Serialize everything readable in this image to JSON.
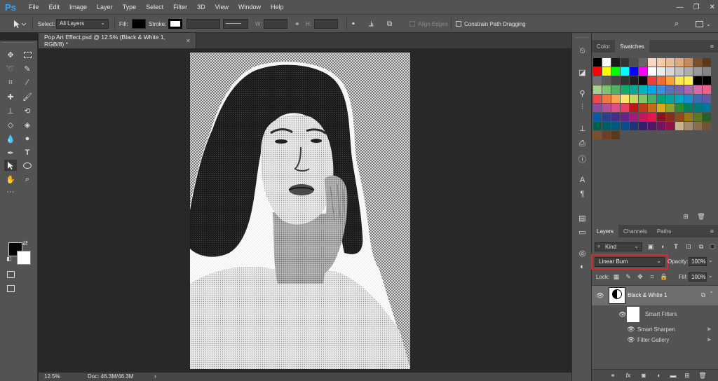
{
  "app": {
    "logo": "Ps"
  },
  "menu": [
    "File",
    "Edit",
    "Image",
    "Layer",
    "Type",
    "Select",
    "Filter",
    "3D",
    "View",
    "Window",
    "Help"
  ],
  "window_controls": {
    "minimize": "—",
    "restore": "❐",
    "close": "✕"
  },
  "options_bar": {
    "select_label": "Select:",
    "select_value": "All Layers",
    "fill_label": "Fill:",
    "stroke_label": "Stroke:",
    "w_label": "W:",
    "h_label": "H:",
    "align_edges_label": "Align Edges",
    "constrain_label": "Constrain Path Dragging",
    "fill_color": "#000000"
  },
  "document": {
    "tab_title": "Pop Art Effect.psd @ 12.5% (Black & White 1, RGB/8) *",
    "close": "×"
  },
  "status": {
    "zoom": "12.5%",
    "doc_info": "Doc: 46.3M/46.3M",
    "arrow": "›"
  },
  "colors": {
    "foreground": "#050505",
    "background": "#ffffff",
    "accent_highlight": "#e0262d"
  },
  "swatches_panel": {
    "tabs": [
      "Color",
      "Swatches"
    ],
    "active_tab": "Swatches",
    "rows": [
      [
        "#000000",
        "#ffffff",
        "#1a1a1a",
        "#333333",
        "#4d4d4d",
        "#666666",
        "#fbd7c2",
        "#f6c9a9",
        "#eebc96",
        "#e0a97e",
        "#c68a5d",
        "#7a4f2b",
        "#5a3a1d"
      ],
      [
        "#ff0000",
        "#ffff00",
        "#00ff00",
        "#00ffff",
        "#0000ff",
        "#ff00ff",
        "#ffffff",
        "#ebebeb",
        "#d6d6d6",
        "#c2c2c2",
        "#adadad",
        "#999999",
        "#858585"
      ],
      [
        "#707070",
        "#5c5c5c",
        "#474747",
        "#333333",
        "#1f1f1f",
        "#0a0a0a",
        "#ef3d3c",
        "#f36b34",
        "#f8a237",
        "#fee64d",
        "#fdf156",
        "#000000",
        "#000000"
      ],
      [
        "#a7d08c",
        "#7dc471",
        "#4fb161",
        "#15a86b",
        "#0ba796",
        "#00b3bc",
        "#00a6e7",
        "#3a8ed7",
        "#5b6fb6",
        "#7a62ad",
        "#a968ad",
        "#d56aa6",
        "#ef6086"
      ],
      [
        "#ee4b48",
        "#f4773f",
        "#f9a54e",
        "#fee567",
        "#c4da5f",
        "#81c567",
        "#44b068",
        "#00a17f",
        "#00a3a0",
        "#00a6c2",
        "#1b8ecf",
        "#3f6bb6",
        "#6358a6"
      ],
      [
        "#8c4d9f",
        "#b24f99",
        "#df4e89",
        "#ec3f66",
        "#b8181a",
        "#bf3b1a",
        "#c56b1a",
        "#d9a81a",
        "#8aa325",
        "#2f8a2f",
        "#00805c",
        "#007b7d",
        "#00759f"
      ],
      [
        "#085aa4",
        "#283f8f",
        "#452e88",
        "#652584",
        "#9b1e7a",
        "#c4165c",
        "#e8154a",
        "#86131d",
        "#8a2e19",
        "#8d4d1a",
        "#997617",
        "#5d7921",
        "#275e2a"
      ],
      [
        "#00604a",
        "#005f61",
        "#00597a",
        "#0a4d8a",
        "#1f3578",
        "#351e6e",
        "#511868",
        "#751363",
        "#951145",
        "#c8b38d",
        "#a58d6b",
        "#8a6f4d",
        "#6e5438"
      ],
      [
        "#7a4f2b",
        "#6b3f1f",
        "#5a3a1d"
      ]
    ]
  },
  "layers_panel": {
    "tabs": [
      "Layers",
      "Channels",
      "Paths"
    ],
    "active_tab": "Layers",
    "filter_kind": "Kind",
    "blend_mode": "Linear Burn",
    "opacity_label": "Opacity:",
    "opacity_value": "100%",
    "lock_label": "Lock:",
    "fill_label": "Fill:",
    "fill_value": "100%",
    "layers": [
      {
        "name": "Black & White 1"
      },
      {
        "name": "Smart Filters"
      },
      {
        "name": "Smart Sharpen"
      },
      {
        "name": "Filter Gallery"
      }
    ]
  }
}
